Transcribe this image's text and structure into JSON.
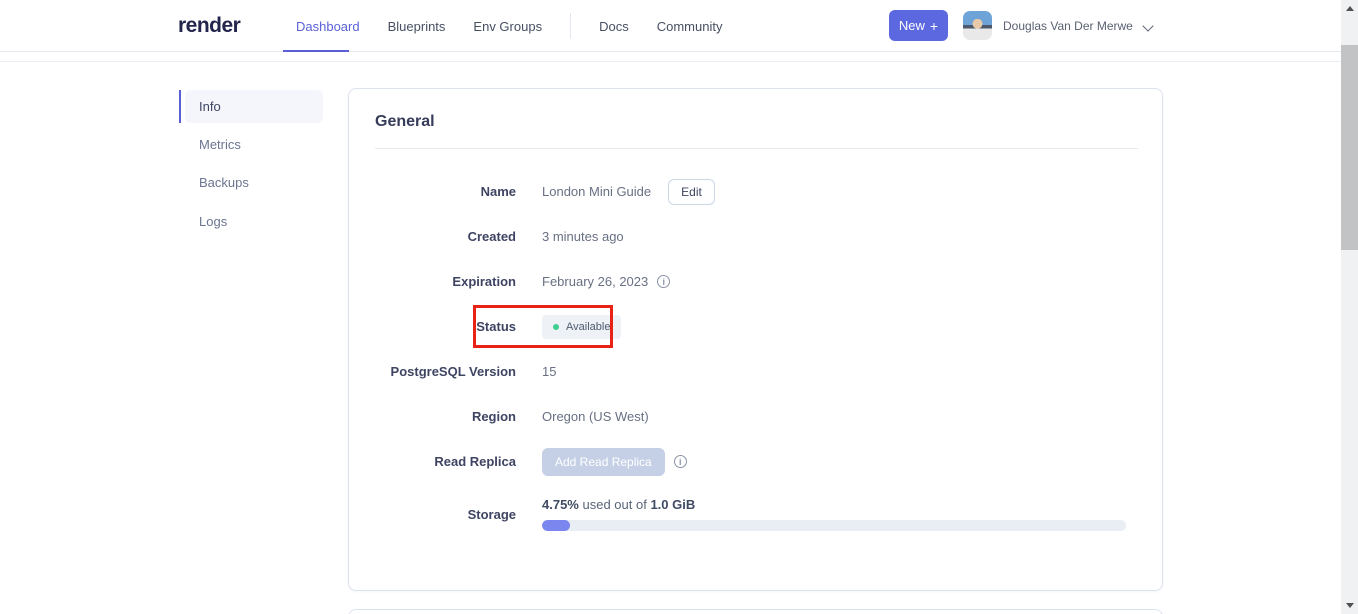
{
  "navbar": {
    "logo": "render",
    "links": [
      {
        "label": "Dashboard",
        "active": true
      },
      {
        "label": "Blueprints",
        "active": false
      },
      {
        "label": "Env Groups",
        "active": false
      },
      {
        "label": "Docs",
        "active": false
      },
      {
        "label": "Community",
        "active": false
      }
    ],
    "new_button": {
      "label": "New",
      "plus": "+"
    },
    "user_name": "Douglas Van Der Merwe"
  },
  "sidebar": {
    "items": [
      {
        "label": "Info",
        "active": true
      },
      {
        "label": "Metrics",
        "active": false
      },
      {
        "label": "Backups",
        "active": false
      },
      {
        "label": "Logs",
        "active": false
      }
    ]
  },
  "card": {
    "title": "General",
    "rows": {
      "name": {
        "label": "Name",
        "value": "London Mini Guide",
        "edit_label": "Edit"
      },
      "created": {
        "label": "Created",
        "value": "3 minutes ago"
      },
      "expiration": {
        "label": "Expiration",
        "value": "February 26, 2023",
        "info_glyph": "i"
      },
      "status": {
        "label": "Status",
        "badge": "Available",
        "dot_color": "#3ecf8e",
        "annotated": true
      },
      "version": {
        "label": "PostgreSQL Version",
        "value": "15"
      },
      "region": {
        "label": "Region",
        "value": "Oregon (US West)"
      },
      "read_replica": {
        "label": "Read Replica",
        "button_label": "Add Read Replica",
        "button_disabled": true,
        "info_glyph": "i"
      },
      "storage": {
        "label": "Storage",
        "used_percent": "4.75%",
        "middle_text": " used out of ",
        "total": "1.0 GiB",
        "fill_style": "width:4.75%"
      }
    }
  },
  "colors": {
    "accent": "#5a5fd8",
    "new_button_bg": "#5b68e0",
    "annotation_red": "#e82315",
    "status_dot_green": "#3ecf8e",
    "progress_fill": "#7b86ef",
    "card_border": "#dde3ec"
  }
}
